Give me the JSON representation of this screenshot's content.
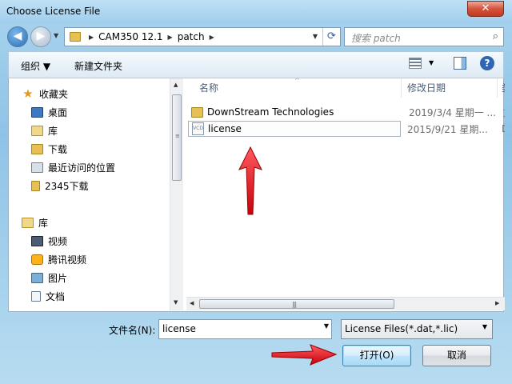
{
  "window": {
    "title": "Choose License File",
    "close_glyph": "✕"
  },
  "nav": {
    "back_glyph": "◀",
    "forward_glyph": "▶",
    "breadcrumb": [
      "CAM350 12.1",
      "patch"
    ],
    "search_placeholder": "搜索 patch",
    "refresh_icon": "refresh-icon"
  },
  "toolbar": {
    "organize_label": "组织 ▼",
    "new_folder_label": "新建文件夹",
    "help_glyph": "?"
  },
  "sidebar": {
    "items": [
      {
        "label": "收藏夹",
        "icon": "star-icon",
        "glyph": "★"
      },
      {
        "label": "桌面",
        "icon": "desktop-icon"
      },
      {
        "label": "库",
        "icon": "library-icon"
      },
      {
        "label": "下载",
        "icon": "download-folder-icon"
      },
      {
        "label": "最近访问的位置",
        "icon": "recent-places-icon"
      },
      {
        "label": "2345下载",
        "icon": "folder-icon"
      },
      {
        "label": "库",
        "icon": "library-icon"
      },
      {
        "label": "视频",
        "icon": "video-library-icon"
      },
      {
        "label": "腾讯视频",
        "icon": "tencent-video-icon"
      },
      {
        "label": "图片",
        "icon": "pictures-icon"
      },
      {
        "label": "文档",
        "icon": "documents-icon"
      }
    ]
  },
  "files": {
    "columns": {
      "name": "名称",
      "modified": "修改日期",
      "extra": "类"
    },
    "rows": [
      {
        "name": "DownStream Technologies",
        "date": "2019/3/4 星期一 ...",
        "extra": "文",
        "type": "folder"
      },
      {
        "name": "license",
        "date": "2015/9/21 星期...",
        "extra": "D",
        "type": "file",
        "file_icon_text": "VCD"
      }
    ]
  },
  "footer": {
    "filename_label": "文件名(N):",
    "filename_value": "license",
    "filter_value": "License Files(*.dat,*.lic)",
    "open_label": "打开(O)",
    "cancel_label": "取消"
  },
  "colors": {
    "arrow": "#e8141c",
    "accent": "#3c7fb1"
  }
}
